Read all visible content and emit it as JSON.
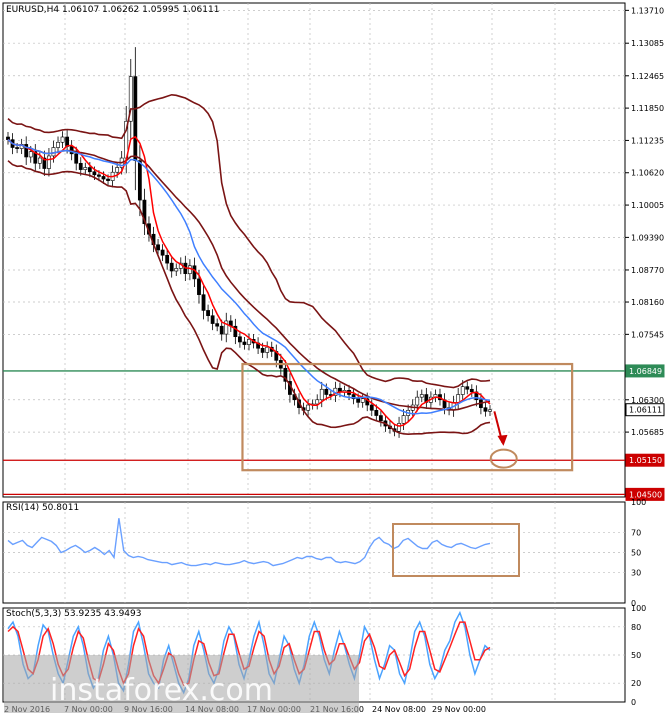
{
  "chart_data": [
    {
      "type": "candlestick",
      "title": "EURUSD,H4  1.06107 1.06262 1.05995 1.06111",
      "ylim": [
        1.0445,
        1.1385
      ],
      "y_ticks": [
        "1.13710",
        "1.13085",
        "1.12465",
        "1.11850",
        "1.11235",
        "1.10620",
        "1.10005",
        "1.09390",
        "1.08770",
        "1.08160",
        "1.07545",
        "1.06300",
        "1.05685"
      ],
      "price_labels": [
        {
          "text": "1.06849",
          "value": 1.06849,
          "color": "#2e8b57"
        },
        {
          "text": "1.06111",
          "value": 1.06111,
          "color": "#000000"
        },
        {
          "text": "1.05150",
          "value": 1.0515,
          "color": "#cc0000"
        },
        {
          "text": "1.04500",
          "value": 1.045,
          "color": "#cc0000"
        }
      ],
      "horizontal_lines": [
        {
          "value": 1.06849,
          "color": "#2e8b57"
        },
        {
          "value": 1.0515,
          "color": "#cc0000"
        },
        {
          "value": 1.045,
          "color": "#cc0000"
        }
      ],
      "x_labels": [
        "2 Nov 2016",
        "7 Nov 00:00",
        "9 Nov 16:00",
        "14 Nov 08:00",
        "17 Nov 00:00",
        "21 Nov 16:00",
        "24 Nov 08:00",
        "29 Nov 00:00"
      ],
      "close_series": [
        1.1125,
        1.111,
        1.1108,
        1.1116,
        1.1092,
        1.1102,
        1.108,
        1.109,
        1.107,
        1.1094,
        1.111,
        1.112,
        1.113,
        1.1112,
        1.1098,
        1.108,
        1.1068,
        1.1072,
        1.1064,
        1.1058,
        1.1055,
        1.105,
        1.1047,
        1.1063,
        1.1072,
        1.109,
        1.116,
        1.1245,
        1.1085,
        1.101,
        1.0965,
        1.0945,
        1.0925,
        1.0915,
        1.0905,
        1.089,
        1.0875,
        1.088,
        1.089,
        1.087,
        1.0885,
        1.086,
        1.083,
        1.08,
        1.079,
        1.0775,
        1.077,
        1.0755,
        1.078,
        1.077,
        1.075,
        1.074,
        1.0735,
        1.0745,
        1.0738,
        1.0728,
        1.072,
        1.073,
        1.0722,
        1.0705,
        1.069,
        1.0665,
        1.064,
        1.063,
        1.0615,
        1.061,
        1.062,
        1.0622,
        1.063,
        1.065,
        1.064,
        1.0638,
        1.0652,
        1.0645,
        1.0648,
        1.064,
        1.0632,
        1.0625,
        1.0632,
        1.062,
        1.061,
        1.06,
        1.059,
        1.058,
        1.0575,
        1.057,
        1.0585,
        1.06,
        1.061,
        1.062,
        1.0635,
        1.064,
        1.0625,
        1.0635,
        1.064,
        1.063,
        1.0615,
        1.061,
        1.0625,
        1.064,
        1.0655,
        1.065,
        1.0645,
        1.063,
        1.0615,
        1.0608,
        1.0611
      ],
      "bollinger": {
        "upper_color": "#7a1414",
        "middle_color": "#7a1414",
        "lower_color": "#7a1414"
      },
      "moving_averages": [
        {
          "color": "#ff0000"
        },
        {
          "color": "#3f7fff"
        }
      ],
      "annotations": [
        {
          "kind": "rectangle",
          "color": "#c08a5e",
          "x0": 0.385,
          "x1": 0.915,
          "y0": 1.0698,
          "y1": 1.0496
        },
        {
          "kind": "ellipse",
          "color": "#c08a5e",
          "x": 0.805,
          "y": 1.0518
        },
        {
          "kind": "arrow",
          "color": "#cc0000",
          "x0": 0.79,
          "y0": 1.0608,
          "x1": 0.803,
          "y1": 1.0548
        }
      ]
    },
    {
      "type": "line",
      "title": "RSI(14) 50.8011",
      "ylim": [
        0,
        100
      ],
      "y_ticks": [
        "100",
        "70",
        "50",
        "30",
        "0"
      ],
      "line_color": "#6aa0ff",
      "values": [
        62,
        58,
        60,
        62,
        57,
        55,
        60,
        65,
        63,
        61,
        57,
        50,
        52,
        55,
        57,
        54,
        50,
        52,
        55,
        52,
        48,
        52,
        45,
        84,
        52,
        47,
        45,
        46,
        45,
        43,
        42,
        41,
        40,
        40,
        38,
        39,
        40,
        38,
        37,
        37,
        38,
        39,
        38,
        40,
        39,
        38,
        38,
        39,
        40,
        42,
        40,
        39,
        40,
        41,
        40,
        37,
        38,
        39,
        41,
        43,
        45,
        44,
        46,
        46,
        44,
        43,
        45,
        45,
        41,
        40,
        41,
        40,
        39,
        41,
        45,
        55,
        62,
        65,
        60,
        58,
        54,
        56,
        62,
        64,
        60,
        56,
        54,
        54,
        60,
        62,
        58,
        56,
        55,
        58,
        59,
        57,
        55,
        54,
        56,
        58,
        59
      ],
      "annotations": [
        {
          "kind": "rectangle",
          "color": "#c08a5e"
        }
      ]
    },
    {
      "type": "line",
      "title": "Stoch(5,3,3) 53.9235 43.9493",
      "ylim": [
        0,
        100
      ],
      "y_ticks": [
        "100",
        "80",
        "50",
        "20",
        "0"
      ],
      "series": [
        {
          "color": "#4aa3ff",
          "values": [
            78,
            85,
            70,
            40,
            25,
            30,
            60,
            82,
            75,
            50,
            30,
            20,
            45,
            70,
            80,
            60,
            30,
            15,
            25,
            55,
            70,
            50,
            20,
            12,
            40,
            75,
            85,
            60,
            30,
            20,
            15,
            45,
            60,
            40,
            20,
            10,
            25,
            60,
            75,
            55,
            30,
            20,
            35,
            65,
            80,
            70,
            40,
            25,
            45,
            70,
            85,
            60,
            30,
            20,
            45,
            70,
            60,
            35,
            20,
            40,
            70,
            85,
            70,
            45,
            30,
            55,
            75,
            60,
            40,
            25,
            50,
            80,
            70,
            45,
            25,
            40,
            60,
            55,
            30,
            20,
            45,
            75,
            85,
            70,
            40,
            25,
            35,
            55,
            65,
            85,
            95,
            80,
            50,
            30,
            45,
            60,
            55
          ]
        },
        {
          "color": "#ff2222",
          "values": [
            75,
            80,
            75,
            55,
            35,
            30,
            45,
            70,
            78,
            62,
            40,
            28,
            35,
            58,
            75,
            68,
            45,
            25,
            22,
            40,
            62,
            55,
            35,
            20,
            30,
            60,
            78,
            70,
            45,
            28,
            20,
            35,
            52,
            48,
            30,
            18,
            20,
            45,
            65,
            62,
            42,
            28,
            30,
            52,
            72,
            72,
            52,
            35,
            38,
            58,
            75,
            70,
            45,
            30,
            38,
            58,
            62,
            45,
            30,
            35,
            55,
            75,
            75,
            55,
            40,
            45,
            62,
            62,
            48,
            35,
            42,
            65,
            72,
            58,
            38,
            35,
            50,
            55,
            42,
            28,
            35,
            58,
            75,
            75,
            55,
            35,
            32,
            45,
            58,
            72,
            85,
            85,
            65,
            45,
            45,
            55,
            58
          ]
        }
      ]
    }
  ],
  "watermark": "instaforex.com"
}
